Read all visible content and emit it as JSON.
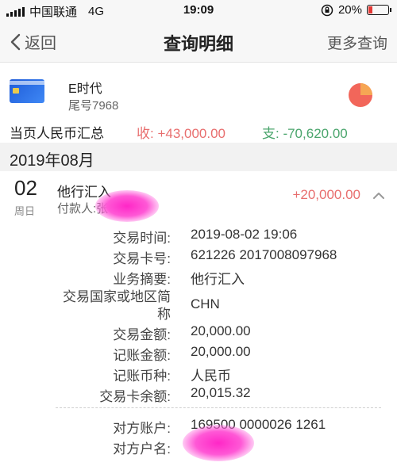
{
  "status_bar": {
    "carrier": "中国联通",
    "network": "4G",
    "time": "19:09",
    "battery": "20%",
    "battery_level": 0.2,
    "battery_color": "#e53935"
  },
  "nav": {
    "back_label": "返回",
    "title": "查询明细",
    "more_label": "更多查询"
  },
  "card": {
    "name": "E时代",
    "tail": "尾号7968",
    "chart_icon": "pie-chart-icon"
  },
  "summary": {
    "label": "当页人民币汇总",
    "income": "收: +43,000.00",
    "expense": "支: -70,620.00",
    "income_color": "#e86e6e",
    "expense_color": "#4aa56c"
  },
  "month": "2019年08月",
  "transaction": {
    "day": "02",
    "weekday": "周日",
    "type": "他行汇入",
    "payer": "付款人:张",
    "amount": "+20,000.00",
    "expanded": true
  },
  "details": [
    {
      "label": "交易时间:",
      "value": "2019-08-02 19:06"
    },
    {
      "label": "交易卡号:",
      "value": "621226 2017008097968"
    },
    {
      "label": "业务摘要:",
      "value": "他行汇入"
    },
    {
      "label": "交易国家或地区简称",
      "value": "CHN"
    },
    {
      "label": "交易金额:",
      "value": "20,000.00"
    },
    {
      "label": "记账金额:",
      "value": "20,000.00"
    },
    {
      "label": "记账币种:",
      "value": "人民币"
    },
    {
      "label": "交易卡余额:",
      "value": "20,015.32"
    }
  ],
  "counterparty": [
    {
      "label": "对方账户:",
      "value": "169500 0000026 1261"
    },
    {
      "label": "对方户名:",
      "value": ""
    }
  ]
}
